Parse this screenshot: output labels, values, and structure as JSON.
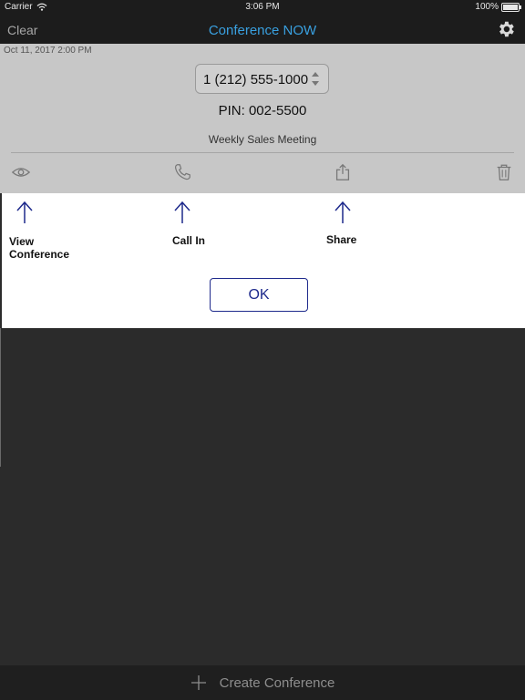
{
  "status_bar": {
    "carrier": "Carrier",
    "time": "3:06 PM",
    "battery": "100%"
  },
  "nav": {
    "left": "Clear",
    "title": "Conference NOW",
    "settings_icon": "gear-icon"
  },
  "conference": {
    "date": "Oct 11, 2017 2:00 PM",
    "phone": "1 (212) 555-1000",
    "pin": "PIN: 002-5500",
    "title": "Weekly Sales Meeting"
  },
  "actions": [
    "eye-icon",
    "phone-icon",
    "share-icon",
    "trash-icon"
  ],
  "hints": {
    "view": "View\nConference",
    "call": "Call In",
    "share": "Share",
    "ok": "OK"
  },
  "bottom": {
    "create_label": "Create Conference"
  },
  "colors": {
    "accent": "#39a0e0",
    "hint": "#1e2a8c",
    "panel": "#c7c7c7",
    "bg": "#2b2b2b"
  }
}
